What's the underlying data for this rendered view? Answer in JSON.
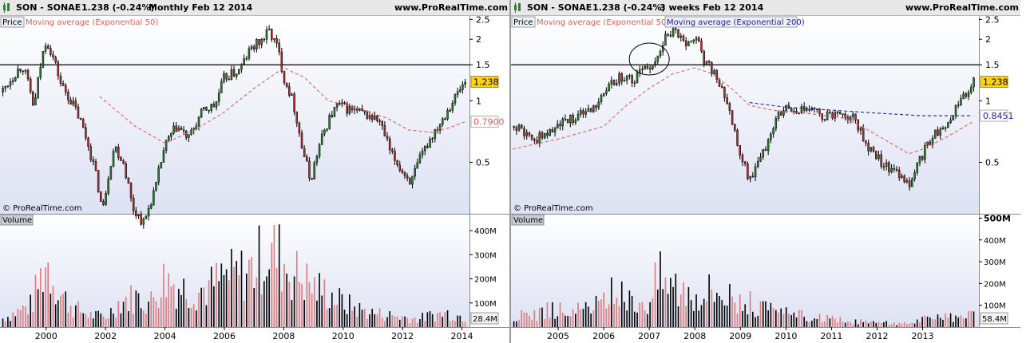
{
  "colors": {
    "bull": "#2f7d2f",
    "bear": "#b03030",
    "vol_up": "#000000",
    "vol_down": "#e07a7a",
    "ema50": "#e06060",
    "ema200": "#2020a0",
    "plot_bg_top": "#ffffff",
    "plot_bg_bottom": "#dde2f3",
    "last_price_bg": "#ffd21a"
  },
  "left_chart": {
    "header": {
      "symbol": "SON - SONAE",
      "price": "1.238 (-0.24%)",
      "period": "Monthly  Feb 12 2014",
      "brand": "www.ProRealTime.com"
    },
    "legend": {
      "price": "Price",
      "ema50": "Moving average (Exponential 50)"
    },
    "watermark": "© ProRealTime.com",
    "volume_label": "Volume",
    "price_axis_labels": [
      "2.5",
      "2",
      "1.5",
      "1",
      "0.5"
    ],
    "last_price_badge": "1.238",
    "ema50_badge": "0.7900",
    "volume_axis_labels": [
      "400M",
      "300M",
      "200M",
      "100M"
    ],
    "volume_badge": "28.4M",
    "x_axis_labels": [
      "2000",
      "2002",
      "2004",
      "2006",
      "2008",
      "2010",
      "2012",
      "2014"
    ]
  },
  "right_chart": {
    "header": {
      "symbol": "SON - SONAE",
      "price": "1.238 (-0.24%)",
      "period": "3 weeks  Feb 12 2014",
      "brand": "www.ProRealTime.com"
    },
    "legend": {
      "price": "Price",
      "ema50": "Moving average (Exponential 50)",
      "ema200": "Moving average (Exponential 200)"
    },
    "watermark": "© ProRealTime.com",
    "volume_label": "Volume",
    "price_axis_labels": [
      "2.5",
      "2",
      "1.5",
      "1",
      "0.5"
    ],
    "last_price_badge": "1.238",
    "ema200_badge": "0.8451",
    "volume_axis_labels": [
      "500M",
      "400M",
      "300M",
      "200M",
      "100M"
    ],
    "volume_badge": "58.4M",
    "x_axis_labels": [
      "2005",
      "2006",
      "2007",
      "2008",
      "2009",
      "2010",
      "2011",
      "2012",
      "2013"
    ]
  },
  "chart_data": [
    {
      "type": "candlestick",
      "title": "SON - SONAE Monthly Feb 12 2014",
      "y_scale": "log",
      "ylim": [
        0.28,
        2.6
      ],
      "x_range": [
        1998.5,
        2014.2
      ],
      "horizontal_line": 1.5,
      "price_path": [
        [
          1998.5,
          1.1
        ],
        [
          1999.2,
          1.5
        ],
        [
          1999.6,
          0.9
        ],
        [
          2000.0,
          2.0
        ],
        [
          2000.5,
          1.2
        ],
        [
          2001.0,
          0.9
        ],
        [
          2001.5,
          0.55
        ],
        [
          2001.9,
          0.28
        ],
        [
          2002.3,
          0.6
        ],
        [
          2002.6,
          0.5
        ],
        [
          2002.9,
          0.3
        ],
        [
          2003.3,
          0.25
        ],
        [
          2003.7,
          0.38
        ],
        [
          2004.0,
          0.6
        ],
        [
          2004.4,
          0.75
        ],
        [
          2004.8,
          0.65
        ],
        [
          2005.3,
          0.9
        ],
        [
          2005.7,
          0.95
        ],
        [
          2006.0,
          1.3
        ],
        [
          2006.5,
          1.4
        ],
        [
          2006.9,
          1.8
        ],
        [
          2007.3,
          2.0
        ],
        [
          2007.5,
          2.2
        ],
        [
          2007.8,
          1.8
        ],
        [
          2008.0,
          1.3
        ],
        [
          2008.3,
          1.0
        ],
        [
          2008.6,
          0.6
        ],
        [
          2008.9,
          0.4
        ],
        [
          2009.2,
          0.6
        ],
        [
          2009.5,
          0.8
        ],
        [
          2009.8,
          0.95
        ],
        [
          2010.3,
          0.9
        ],
        [
          2010.8,
          0.85
        ],
        [
          2011.2,
          0.8
        ],
        [
          2011.6,
          0.55
        ],
        [
          2012.0,
          0.45
        ],
        [
          2012.3,
          0.4
        ],
        [
          2012.8,
          0.6
        ],
        [
          2013.3,
          0.8
        ],
        [
          2013.7,
          1.0
        ],
        [
          2014.1,
          1.238
        ]
      ],
      "ema50": [
        [
          2001.8,
          1.05
        ],
        [
          2003.0,
          0.75
        ],
        [
          2004.0,
          0.62
        ],
        [
          2005.0,
          0.72
        ],
        [
          2006.0,
          0.88
        ],
        [
          2007.0,
          1.15
        ],
        [
          2008.0,
          1.45
        ],
        [
          2008.7,
          1.3
        ],
        [
          2009.5,
          1.0
        ],
        [
          2010.5,
          0.92
        ],
        [
          2011.5,
          0.82
        ],
        [
          2012.2,
          0.72
        ],
        [
          2013.0,
          0.7
        ],
        [
          2013.6,
          0.74
        ],
        [
          2014.1,
          0.79
        ]
      ],
      "volume_path": [
        [
          1998.5,
          40
        ],
        [
          1999.5,
          110
        ],
        [
          2000.0,
          330
        ],
        [
          2000.5,
          160
        ],
        [
          2001.0,
          90
        ],
        [
          2001.5,
          60
        ],
        [
          2002.0,
          50
        ],
        [
          2002.5,
          130
        ],
        [
          2003.0,
          150
        ],
        [
          2003.5,
          120
        ],
        [
          2004.0,
          250
        ],
        [
          2004.5,
          200
        ],
        [
          2005.0,
          180
        ],
        [
          2005.5,
          200
        ],
        [
          2006.0,
          250
        ],
        [
          2006.5,
          260
        ],
        [
          2007.0,
          300
        ],
        [
          2007.3,
          360
        ],
        [
          2007.6,
          380
        ],
        [
          2007.9,
          350
        ],
        [
          2008.2,
          280
        ],
        [
          2008.6,
          250
        ],
        [
          2009.0,
          200
        ],
        [
          2009.5,
          170
        ],
        [
          2010.0,
          120
        ],
        [
          2010.5,
          90
        ],
        [
          2011.0,
          70
        ],
        [
          2011.5,
          60
        ],
        [
          2012.0,
          50
        ],
        [
          2012.5,
          40
        ],
        [
          2013.0,
          60
        ],
        [
          2013.5,
          70
        ],
        [
          2014.1,
          50
        ]
      ],
      "volume_ylim": [
        0,
        470
      ]
    },
    {
      "type": "candlestick",
      "title": "SON - SONAE 3 weeks Feb 12 2014",
      "y_scale": "log",
      "ylim": [
        0.28,
        2.6
      ],
      "x_range": [
        2004.0,
        2014.2
      ],
      "horizontal_line": 1.5,
      "price_path": [
        [
          2004.0,
          0.75
        ],
        [
          2004.5,
          0.65
        ],
        [
          2005.0,
          0.75
        ],
        [
          2005.5,
          0.85
        ],
        [
          2006.0,
          1.05
        ],
        [
          2006.3,
          1.3
        ],
        [
          2006.6,
          1.25
        ],
        [
          2007.0,
          1.5
        ],
        [
          2007.2,
          1.7
        ],
        [
          2007.4,
          2.1
        ],
        [
          2007.6,
          2.15
        ],
        [
          2007.8,
          1.85
        ],
        [
          2008.0,
          2.1
        ],
        [
          2008.2,
          1.6
        ],
        [
          2008.5,
          1.25
        ],
        [
          2008.8,
          0.8
        ],
        [
          2009.0,
          0.55
        ],
        [
          2009.2,
          0.4
        ],
        [
          2009.5,
          0.55
        ],
        [
          2009.8,
          0.85
        ],
        [
          2010.0,
          0.95
        ],
        [
          2010.4,
          0.9
        ],
        [
          2010.8,
          0.85
        ],
        [
          2011.2,
          0.88
        ],
        [
          2011.5,
          0.82
        ],
        [
          2011.8,
          0.6
        ],
        [
          2012.1,
          0.5
        ],
        [
          2012.4,
          0.45
        ],
        [
          2012.7,
          0.38
        ],
        [
          2012.9,
          0.5
        ],
        [
          2013.2,
          0.65
        ],
        [
          2013.5,
          0.78
        ],
        [
          2013.8,
          0.95
        ],
        [
          2014.1,
          1.238
        ]
      ],
      "ema50": [
        [
          2004.0,
          0.58
        ],
        [
          2005.0,
          0.65
        ],
        [
          2006.0,
          0.75
        ],
        [
          2006.5,
          0.95
        ],
        [
          2007.0,
          1.15
        ],
        [
          2007.5,
          1.35
        ],
        [
          2008.0,
          1.45
        ],
        [
          2008.4,
          1.35
        ],
        [
          2008.8,
          1.15
        ],
        [
          2009.2,
          0.95
        ],
        [
          2009.7,
          0.9
        ],
        [
          2010.2,
          0.88
        ],
        [
          2010.8,
          0.85
        ],
        [
          2011.3,
          0.82
        ],
        [
          2011.8,
          0.72
        ],
        [
          2012.3,
          0.62
        ],
        [
          2012.7,
          0.55
        ],
        [
          2013.0,
          0.58
        ],
        [
          2013.5,
          0.66
        ],
        [
          2014.1,
          0.79
        ]
      ],
      "ema200": [
        [
          2009.2,
          0.98
        ],
        [
          2010.0,
          0.93
        ],
        [
          2011.0,
          0.9
        ],
        [
          2012.0,
          0.87
        ],
        [
          2013.0,
          0.845
        ],
        [
          2014.1,
          0.8451
        ]
      ],
      "volume_path": [
        [
          2004.0,
          60
        ],
        [
          2004.5,
          80
        ],
        [
          2005.0,
          100
        ],
        [
          2005.5,
          90
        ],
        [
          2006.0,
          130
        ],
        [
          2006.2,
          200
        ],
        [
          2006.5,
          150
        ],
        [
          2007.0,
          160
        ],
        [
          2007.2,
          300
        ],
        [
          2007.5,
          250
        ],
        [
          2008.0,
          200
        ],
        [
          2008.5,
          220
        ],
        [
          2009.0,
          150
        ],
        [
          2009.5,
          100
        ],
        [
          2010.0,
          70
        ],
        [
          2010.5,
          60
        ],
        [
          2011.0,
          40
        ],
        [
          2011.5,
          30
        ],
        [
          2012.0,
          25
        ],
        [
          2012.5,
          20
        ],
        [
          2013.0,
          40
        ],
        [
          2013.5,
          50
        ],
        [
          2014.1,
          58.4
        ]
      ],
      "volume_ylim": [
        0,
        520
      ]
    }
  ]
}
